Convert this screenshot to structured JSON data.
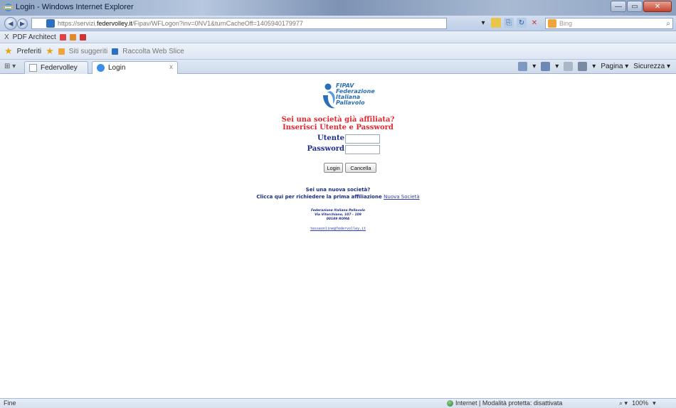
{
  "window": {
    "title": "Login - Windows Internet Explorer",
    "buttons": {
      "minimize": "—",
      "maximize": "▭",
      "close": "✕"
    }
  },
  "addressbar": {
    "url_prefix": "https://servizi.",
    "url_domain": "federvolley.it",
    "url_rest": "/Fipav/WFLogon?inv=0NV1&turnCacheOff=1405940179977",
    "search_placeholder": "Bing",
    "search_icon": "magnifier-icon"
  },
  "pdfbar": {
    "close_glyph": "X",
    "label": "PDF Architect"
  },
  "favorites": {
    "label": "Preferiti",
    "suggested": "Siti suggeriti",
    "gallery": "Raccolta Web Slice"
  },
  "tabs": [
    {
      "label": "Federvolley",
      "active": false
    },
    {
      "label": "Login",
      "active": true
    }
  ],
  "tab_close_glyph": "x",
  "commandbar": {
    "page_label": "Pagina",
    "safety_label": "Sicurezza"
  },
  "page": {
    "logo_lines": [
      "FIPAV",
      "Federazione",
      "Italiana",
      "Pallavolo"
    ],
    "prompt_line1": "Sei una società già affiliata?",
    "prompt_line2": "Inserisci Utente e Password",
    "user_label": "Utente",
    "password_label": "Password",
    "user_value": "",
    "password_value": "",
    "login_button": "Login",
    "cancel_button": "Cancella",
    "new_question": "Sei una nuova società?",
    "new_instruction": "Clicca qui per richiedere la prima affiliazione",
    "new_link": "Nuova Società",
    "address_lines": [
      "Federazione Italiana Pallavolo",
      "Via Vitorchiano, 107 - 109",
      "00189 ROMA"
    ],
    "email": "tesseonline@federvolley.it"
  },
  "status": {
    "left": "Fine",
    "zone": "Internet | Modalità protetta: disattivata",
    "zoom": "100%"
  },
  "colors": {
    "accent_red": "#e3262d",
    "accent_navy": "#1b2c8a",
    "logo_blue": "#2b6fb9"
  }
}
